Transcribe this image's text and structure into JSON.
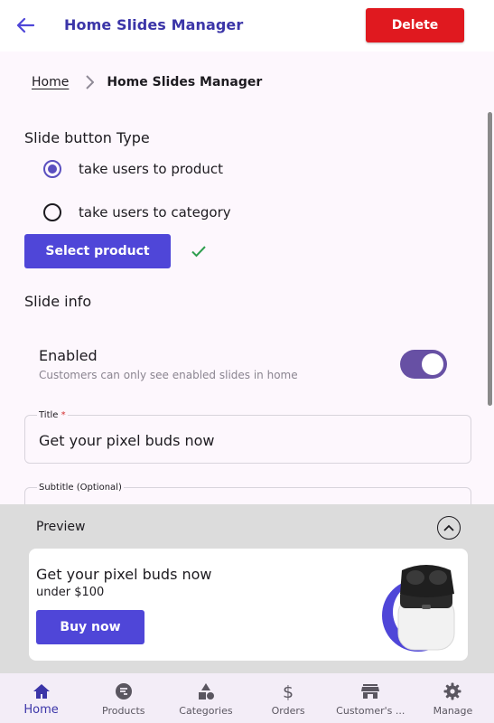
{
  "app_bar": {
    "title": "Home Slides Manager",
    "delete_label": "Delete"
  },
  "breadcrumb": {
    "home": "Home",
    "current": "Home Slides Manager"
  },
  "slide_button": {
    "heading": "Slide button Type",
    "options": [
      {
        "label": "take users to product",
        "selected": true
      },
      {
        "label": "take users to category",
        "selected": false
      }
    ],
    "select_product_label": "Select product",
    "product_selected": true
  },
  "slide_info": {
    "heading": "Slide info",
    "enabled_label": "Enabled",
    "enabled_help": "Customers can only see enabled slides in home",
    "enabled": true,
    "title_label": "Title",
    "title_required_mark": "*",
    "title_value": "Get your pixel buds now",
    "subtitle_label": "Subtitle (Optional)"
  },
  "preview": {
    "heading": "Preview",
    "card_title": "Get your pixel buds now",
    "card_subtitle": "under $100",
    "button_label": "Buy now"
  },
  "bottom_nav": {
    "items": [
      {
        "label": "Home",
        "icon": "home-icon",
        "active": true
      },
      {
        "label": "Products",
        "icon": "products-icon",
        "active": false
      },
      {
        "label": "Categories",
        "icon": "categories-icon",
        "active": false
      },
      {
        "label": "Orders",
        "icon": "dollar-icon",
        "active": false
      },
      {
        "label": "Customer's ...",
        "icon": "storefront-icon",
        "active": false
      },
      {
        "label": "Manage",
        "icon": "gear-icon",
        "active": false
      }
    ]
  },
  "colors": {
    "primary": "#4f46d8",
    "title_color": "#3b35a8",
    "danger": "#e0191f",
    "toggle_on": "#6750a4",
    "success": "#2e9e4f"
  }
}
